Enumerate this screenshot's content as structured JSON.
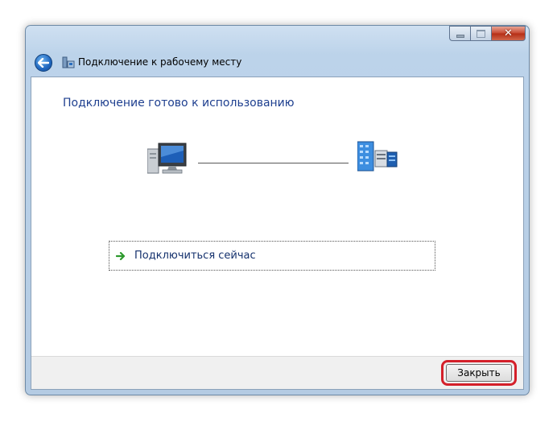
{
  "window": {
    "title": "Подключение к рабочему месту",
    "caption_buttons": [
      "minimize-icon",
      "maximize-icon",
      "close-icon"
    ]
  },
  "content": {
    "heading": "Подключение готово к использованию",
    "connect_now": "Подключиться сейчас"
  },
  "footer": {
    "close_label": "Закрыть"
  },
  "icons": {
    "back": "back-arrow-icon",
    "title": "network-connection-icon",
    "computer": "computer-icon",
    "workplace": "workplace-network-icon",
    "connect_arrow": "green-arrow-icon"
  },
  "colors": {
    "heading": "#1e3f8f",
    "link_text": "#14316d",
    "highlight": "#d4202a",
    "arrow": "#2e9a2e"
  }
}
